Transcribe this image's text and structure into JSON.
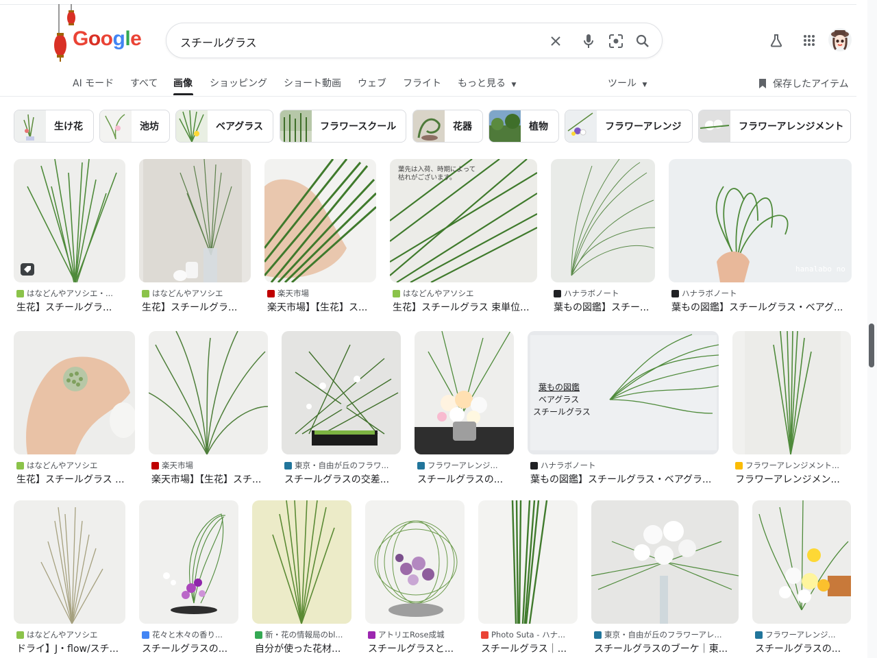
{
  "brand": {
    "logo_text": "Google"
  },
  "search": {
    "query": "スチールグラス"
  },
  "tabs": [
    {
      "label": "AI モード"
    },
    {
      "label": "すべて"
    },
    {
      "label": "画像"
    },
    {
      "label": "ショッピング"
    },
    {
      "label": "ショート動画"
    },
    {
      "label": "ウェブ"
    },
    {
      "label": "フライト"
    },
    {
      "label": "もっと見る"
    },
    {
      "label": "ツール"
    }
  ],
  "saved_items": "保存したアイテム",
  "chips": [
    {
      "label": "生け花"
    },
    {
      "label": "池坊"
    },
    {
      "label": "ベアグラス"
    },
    {
      "label": "フラワースクール"
    },
    {
      "label": "花器"
    },
    {
      "label": "植物"
    },
    {
      "label": "フラワーアレンジ"
    },
    {
      "label": "フラワーアレンジメント"
    }
  ],
  "results": [
    {
      "source": "はなどんやアソシエ・...",
      "title": "生花】スチールグラ...",
      "favicon": "#8bc34a"
    },
    {
      "source": "はなどんやアソシエ",
      "title": "生花】スチールグラ...",
      "favicon": "#8bc34a"
    },
    {
      "source": "楽天市場",
      "title": "楽天市場】【生花】ス...",
      "favicon": "#bf0000"
    },
    {
      "source": "はなどんやアソシエ",
      "title": "生花】スチールグラス 束単位...",
      "favicon": "#8bc34a",
      "overlay": "葉先は入荷、時期によって 枯れがございます。"
    },
    {
      "source": "ハナラボノート",
      "title": "葉もの図鑑】スチー...",
      "favicon": "#202124"
    },
    {
      "source": "ハナラボノート",
      "title": "葉もの図鑑】スチールグラス・ベアグ...",
      "favicon": "#202124",
      "overlay": "hanalabo no"
    },
    {
      "source": "はなどんやアソシエ",
      "title": "生花】スチールグラス ...",
      "favicon": "#8bc34a"
    },
    {
      "source": "楽天市場",
      "title": "楽天市場】【生花】スチ...",
      "favicon": "#bf0000"
    },
    {
      "source": "東京・自由が丘のフラワ...",
      "title": "スチールグラスの交差...",
      "favicon": "#21759b"
    },
    {
      "source": "フラワーアレンジ...",
      "title": "スチールグラスの...",
      "favicon": "#21759b"
    },
    {
      "source": "ハナラボノート",
      "title": "葉もの図鑑】スチールグラス・ベアグラ...",
      "favicon": "#202124",
      "overlay": "葉もの図鑑 ベアグラス スチールグラス"
    },
    {
      "source": "フラワーアレンジメント...",
      "title": "フラワーアレンジメン...",
      "favicon": "#fbbc04"
    },
    {
      "source": "はなどんやアソシエ",
      "title": "ドライ】J・flow/スチ...",
      "favicon": "#8bc34a"
    },
    {
      "source": "花々と木々の香り...",
      "title": "スチールグラスの...",
      "favicon": "#4285f4"
    },
    {
      "source": "新・花の情報局のbl...",
      "title": "自分が使った花材...",
      "favicon": "#34a853"
    },
    {
      "source": "アトリエRose成城",
      "title": "スチールグラスと...",
      "favicon": "#9c27b0"
    },
    {
      "source": "Photo Suta - ハナ...",
      "title": "スチールグラス｜...",
      "favicon": "#ea4335"
    },
    {
      "source": "東京・自由が丘のフラワーアレ...",
      "title": "スチールグラスのブーケ｜東...",
      "favicon": "#21759b"
    },
    {
      "source": "フラワーアレンジ...",
      "title": "スチールグラスの...",
      "favicon": "#21759b"
    }
  ],
  "colors": {
    "accent_text": "#202124",
    "muted_text": "#4d5156",
    "border": "#dadce0",
    "grass": "#4e8a3a"
  }
}
